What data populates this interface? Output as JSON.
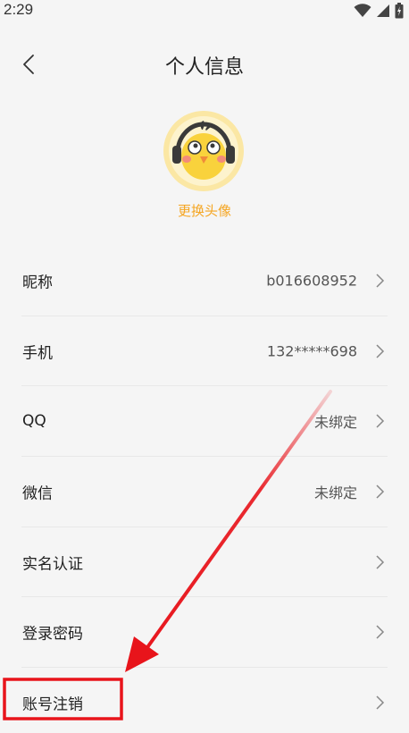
{
  "status_bar": {
    "time": "2:29",
    "icons": [
      "wifi-icon",
      "signal-icon",
      "battery-icon"
    ]
  },
  "header": {
    "title": "个人信息",
    "back_icon": "chevron-left-icon"
  },
  "profile": {
    "avatar_icon": "chick-with-headphones-avatar",
    "change_avatar_label": "更换头像",
    "accent_color": "#f5a623"
  },
  "info_rows": [
    {
      "label": "昵称",
      "value": "b016608952"
    },
    {
      "label": "手机",
      "value": "132*****698"
    },
    {
      "label": "QQ",
      "value": "未绑定"
    },
    {
      "label": "微信",
      "value": "未绑定"
    },
    {
      "label": "实名认证",
      "value": ""
    },
    {
      "label": "登录密码",
      "value": ""
    },
    {
      "label": "账号注销",
      "value": ""
    }
  ],
  "annotation": {
    "arrow_color": "#e8141b",
    "highlight_target": "账号注销"
  }
}
